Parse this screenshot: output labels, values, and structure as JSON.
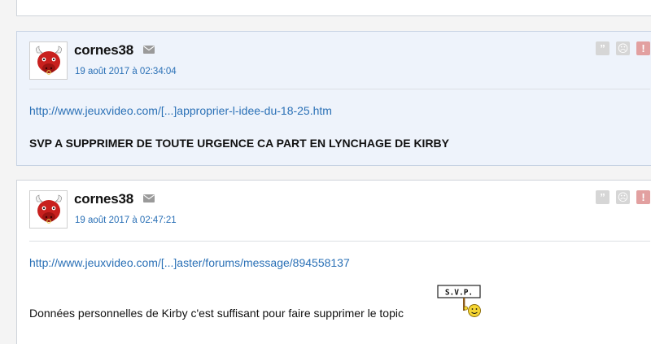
{
  "posts": [
    {
      "author": "cornes38",
      "date": "19 août 2017 à 02:34:04",
      "link": "http://www.jeuxvideo.com/[...]approprier-l-idee-du-18-25.htm",
      "text": "SVP A SUPPRIMER DE TOUTE URGENCE CA PART EN LYNCHAGE DE KIRBY",
      "highlighted": true
    },
    {
      "author": "cornes38",
      "date": "19 août 2017 à 02:47:21",
      "link": "http://www.jeuxvideo.com/[...]aster/forums/message/894558137",
      "text": "Données personnelles de Kirby c'est suffisant pour faire supprimer le topic",
      "sticker_text": "S.V.P.",
      "highlighted": false
    }
  ],
  "actions": {
    "quote": "”",
    "sad": "☹",
    "alert": "!"
  },
  "colors": {
    "link": "#2a70b6",
    "highlight_bg": "#eef3fb",
    "alert": "#e2a0a0"
  },
  "icons": [
    "bull-avatar-icon",
    "mail-icon",
    "quote-icon",
    "sad-face-icon",
    "alert-icon",
    "svp-sticker-icon"
  ]
}
